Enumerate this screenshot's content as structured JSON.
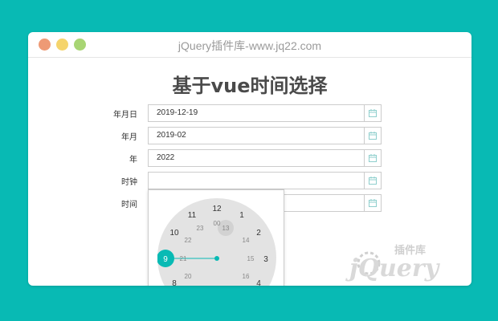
{
  "window": {
    "title": "jQuery插件库-www.jq22.com"
  },
  "page": {
    "heading": "基于vue时间选择"
  },
  "fields": [
    {
      "label": "年月日",
      "value": "2019-12-19"
    },
    {
      "label": "年月",
      "value": "2019-02"
    },
    {
      "label": "年",
      "value": "2022"
    },
    {
      "label": "时钟",
      "value": ""
    },
    {
      "label": "时间",
      "value": ""
    }
  ],
  "clock": {
    "selected_hour": "9",
    "hours_outer": [
      "12",
      "1",
      "2",
      "3",
      "4",
      "8",
      "10",
      "11"
    ],
    "hours_inner": [
      "00",
      "13",
      "14",
      "15",
      "16",
      "17",
      "19",
      "20",
      "21",
      "22",
      "23"
    ],
    "highlighted_inner": "13",
    "accent": "#08bab4"
  },
  "watermark": {
    "brand": "插件库",
    "letters": "jQuery"
  }
}
